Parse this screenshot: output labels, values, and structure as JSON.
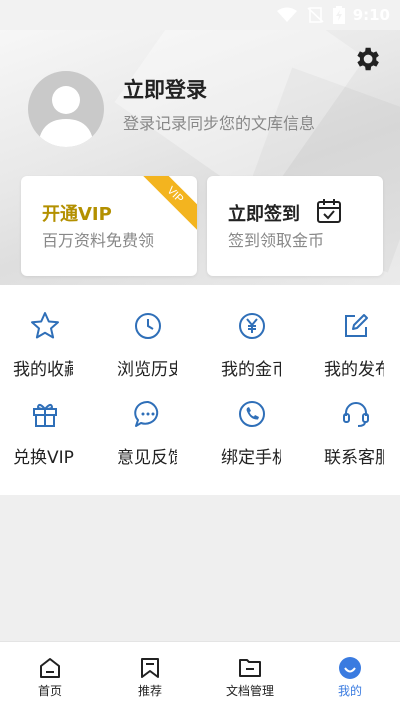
{
  "status_bar": {
    "time": "9:10",
    "icons": [
      "wifi-icon",
      "no-sim-icon",
      "battery-icon"
    ]
  },
  "header": {
    "login_title": "立即登录",
    "login_subtitle": "登录记录同步您的文库信息",
    "settings_icon": "gear-icon"
  },
  "cards": {
    "vip": {
      "title": "开通VIP",
      "subtitle": "百万资料免费领",
      "ribbon": "VIP"
    },
    "sign": {
      "title": "立即签到",
      "subtitle": "签到领取金币"
    }
  },
  "grid": [
    {
      "label": "我的收藏",
      "icon": "star-icon"
    },
    {
      "label": "浏览历史",
      "icon": "clock-icon"
    },
    {
      "label": "我的金币",
      "icon": "yen-coin-icon"
    },
    {
      "label": "我的发布",
      "icon": "edit-icon"
    },
    {
      "label": "兑换VIP",
      "icon": "gift-icon"
    },
    {
      "label": "意见反馈",
      "icon": "chat-bubble-icon"
    },
    {
      "label": "绑定手机",
      "icon": "phone-icon"
    },
    {
      "label": "联系客服",
      "icon": "headset-icon"
    }
  ],
  "bottom_nav": [
    {
      "label": "首页",
      "icon": "home-icon",
      "active": false
    },
    {
      "label": "推荐",
      "icon": "bookmark-icon",
      "active": false
    },
    {
      "label": "文档管理",
      "icon": "folder-icon",
      "active": false
    },
    {
      "label": "我的",
      "icon": "profile-face-icon",
      "active": true
    }
  ],
  "colors": {
    "accent_blue": "#3a7be0",
    "vip_gold": "#b39000",
    "ribbon_orange": "#f3b41f",
    "icon_blue": "#2f6fb8"
  }
}
